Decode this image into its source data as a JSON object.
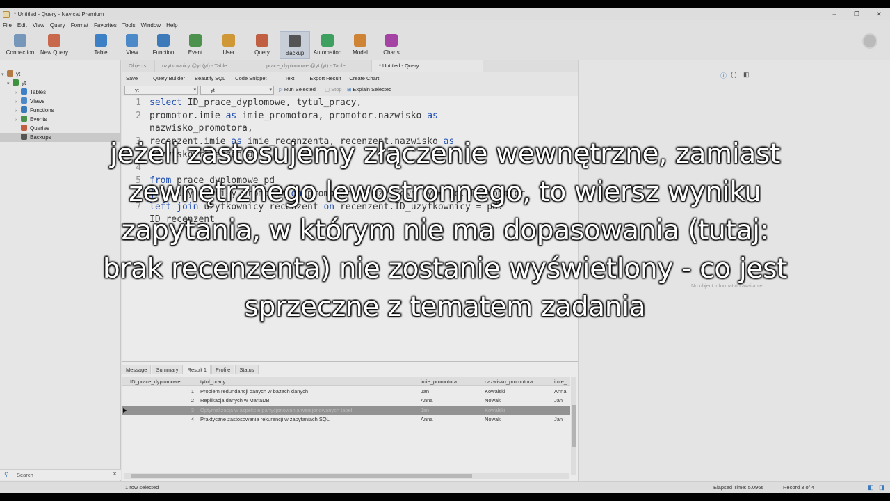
{
  "window": {
    "title": "* Untitled - Query - Navicat Premium",
    "controls": [
      "–",
      "❐",
      "✕"
    ]
  },
  "menu": [
    "File",
    "Edit",
    "View",
    "Query",
    "Format",
    "Favorites",
    "Tools",
    "Window",
    "Help"
  ],
  "toolbar": [
    {
      "label": "Connection",
      "icon": "connection-icon",
      "color": "#7aa0c8"
    },
    {
      "label": "New Query",
      "icon": "new-query-icon",
      "color": "#d86a4a"
    },
    {
      "label": "Table",
      "icon": "table-icon",
      "color": "#3a86d4"
    },
    {
      "label": "View",
      "icon": "view-icon",
      "color": "#4a90d9"
    },
    {
      "label": "Function",
      "icon": "function-icon",
      "color": "#3a7fc8"
    },
    {
      "label": "Event",
      "icon": "event-icon",
      "color": "#4a9a4a"
    },
    {
      "label": "User",
      "icon": "user-icon",
      "color": "#e0a030"
    },
    {
      "label": "Query",
      "icon": "query-icon",
      "color": "#d06040"
    },
    {
      "label": "Backup",
      "icon": "backup-icon",
      "color": "#555555"
    },
    {
      "label": "Automation",
      "icon": "automation-icon",
      "color": "#3aaa60"
    },
    {
      "label": "Model",
      "icon": "model-icon",
      "color": "#e08a30"
    },
    {
      "label": "Charts",
      "icon": "charts-icon",
      "color": "#b040b0"
    }
  ],
  "sidebar": {
    "items": [
      {
        "label": "yt",
        "icon": "connection-icon",
        "color": "#c08040"
      },
      {
        "label": "yt",
        "icon": "database-icon",
        "color": "#3a9a3a"
      },
      {
        "label": "Tables",
        "icon": "table-icon",
        "color": "#3a86d4"
      },
      {
        "label": "Views",
        "icon": "view-icon",
        "color": "#4a90d9"
      },
      {
        "label": "Functions",
        "icon": "function-icon",
        "color": "#3a7fc8"
      },
      {
        "label": "Events",
        "icon": "event-icon",
        "color": "#4a9a4a"
      },
      {
        "label": "Queries",
        "icon": "query-icon",
        "color": "#d06040"
      },
      {
        "label": "Backups",
        "icon": "backup-icon",
        "color": "#555555"
      }
    ],
    "search_label": "Search"
  },
  "tabs": [
    {
      "label": "Objects"
    },
    {
      "label": "uzytkownicy @yt (yt) - Table"
    },
    {
      "label": "prace_dyplomowe @yt (yt) - Table"
    },
    {
      "label": "* Untitled - Query"
    }
  ],
  "query_toolbar": [
    "Save",
    "Query Builder",
    "Beautify SQL",
    "Code Snippet",
    "Text",
    "Export Result",
    "Create Chart"
  ],
  "selectors": {
    "connection": "yt",
    "database": "yt",
    "run_selected": "Run Selected",
    "stop": "Stop",
    "explain_selected": "Explain Selected"
  },
  "code_lines": [
    {
      "n": "1",
      "text": "select ID_prace_dyplomowe, tytul_pracy,"
    },
    {
      "n": "2",
      "text": "promotor.imie as imie_promotora, promotor.nazwisko as"
    },
    {
      "n": "",
      "text": "nazwisko_promotora,"
    },
    {
      "n": "3",
      "text": "recenzent.imie as imie_recenzenta, recenzent.nazwisko as"
    },
    {
      "n": "",
      "text": "nazwisko_recenzenta"
    },
    {
      "n": "4",
      "text": ""
    },
    {
      "n": "5",
      "text": "from prace_dyplomowe pd"
    },
    {
      "n": "6",
      "text": "join uzytkownicy promotor on promotor.ID_uzytkownicy = pd.ID_promotor"
    },
    {
      "n": "7",
      "text": "left join uzytkownicy recenzent on recenzent.ID_uzytkownicy = pd."
    },
    {
      "n": "",
      "text": "ID_recenzent"
    }
  ],
  "results": {
    "tabs": [
      "Message",
      "Summary",
      "Result 1",
      "Profile",
      "Status"
    ],
    "columns": [
      "ID_prace_dyplomowe",
      "tytul_pracy",
      "imie_promotora",
      "nazwisko_promotora",
      "imie_"
    ],
    "rows": [
      [
        "1",
        "Problem redundancji danych w bazach danych",
        "Jan",
        "Kowalski",
        "Anna"
      ],
      [
        "2",
        "Replikacja danych w MariaDB",
        "Anna",
        "Nowak",
        "Jan"
      ],
      [
        "3",
        "Optymalizacja w aspekcie partycjonowania wersjonowanych tabel",
        "Jan",
        "Kowalski",
        ""
      ],
      [
        "4",
        "Praktyczne zastosowania rekurencji w zapytaniach SQL",
        "Anna",
        "Nowak",
        "Jan"
      ]
    ],
    "selected_row": 2
  },
  "right_panel": {
    "empty_text": "No object information available."
  },
  "status": {
    "left": "1 row selected",
    "elapsed": "Elapsed Time: 5.096s",
    "record": "Record 3 of 4"
  },
  "subtitle": "jeżeli zastosujemy złączenie wewnętrzne, zamiast zewnętrznego lewostronnego, to wiersz wyniku zapytania, w którym nie ma dopasowania (tutaj: brak recenzenta) nie zostanie wyświetlony - co jest sprzeczne z tematem zadania"
}
